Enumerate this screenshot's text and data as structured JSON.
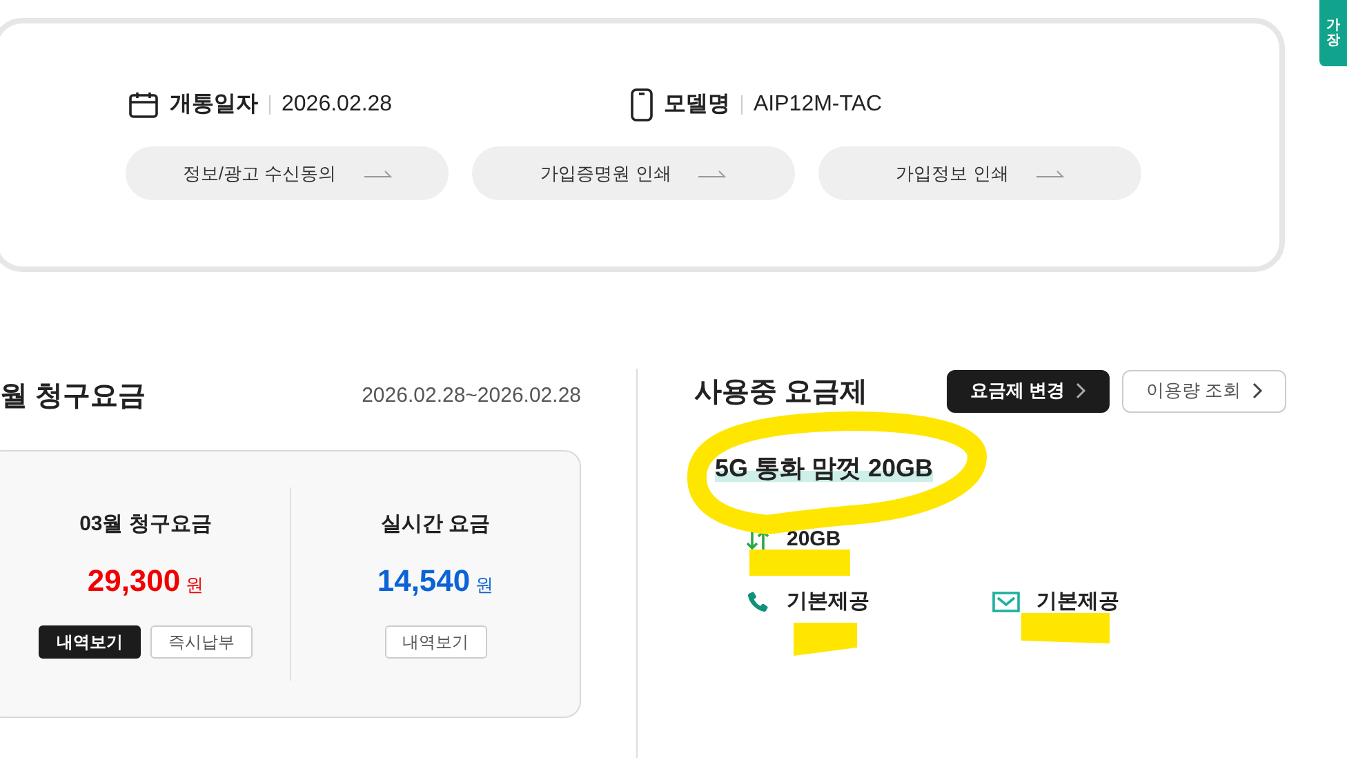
{
  "device_info": [
    {
      "kind": "date",
      "label": "개통일자",
      "value": "2026.02.28"
    },
    {
      "kind": "model",
      "label": "모델명",
      "value": "AIP12M-TAC"
    }
  ],
  "info_buttons": [
    "정보/광고 수신동의",
    "가입증명원 인쇄",
    "가입정보 인쇄"
  ],
  "side_tab": {
    "lines": [
      "가",
      "장"
    ]
  },
  "bill": {
    "title": "월 청구요금",
    "period": "2026.02.28~2026.02.28",
    "columns": [
      {
        "kind": "billed",
        "title": "03월 청구요금",
        "amount": "29,300",
        "unit": "원",
        "buttons": [
          {
            "label": "내역보기",
            "primary": true
          },
          {
            "label": "즉시납부",
            "primary": false
          }
        ]
      },
      {
        "kind": "realtime",
        "title": "실시간 요금",
        "amount": "14,540",
        "unit": "원",
        "buttons": [
          {
            "label": "내역보기",
            "primary": false
          }
        ]
      }
    ]
  },
  "plan": {
    "title": "사용중 요금제",
    "buttons": [
      {
        "label": "요금제 변경",
        "primary": true
      },
      {
        "label": "이용량 조회",
        "primary": false
      }
    ],
    "name": "5G 통화 맘껏 20GB",
    "features": [
      {
        "kind": "data",
        "value": "20GB"
      },
      {
        "kind": "voice",
        "value": "기본제공"
      },
      {
        "kind": "sms",
        "value": "기본제공"
      }
    ]
  }
}
